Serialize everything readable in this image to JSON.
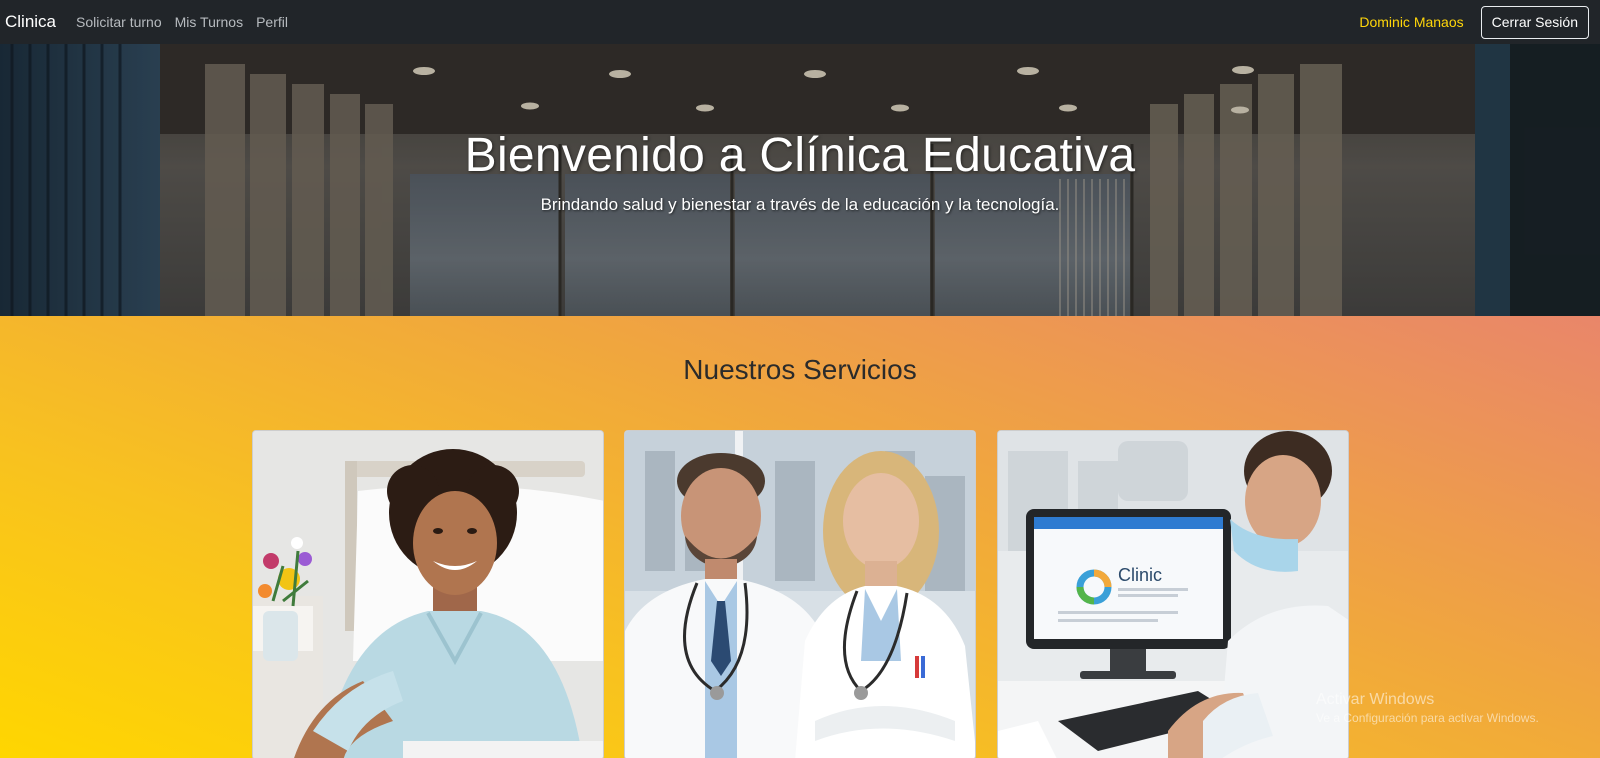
{
  "navbar": {
    "brand": "Clinica",
    "links": [
      "Solicitar turno",
      "Mis Turnos",
      "Perfil"
    ],
    "user_name": "Dominic Manaos",
    "logout_label": "Cerrar Sesión"
  },
  "hero": {
    "title": "Bienvenido a Clínica Educativa",
    "subtitle": "Brindando salud y bienestar a través de la educación y la tecnología."
  },
  "services": {
    "title": "Nuestros Servicios",
    "cards": [
      {
        "image": "smiling-patient-in-hospital-bed"
      },
      {
        "image": "two-doctors-with-stethoscopes"
      },
      {
        "image": "doctor-using-clinic-software",
        "screen_text": "Clinic"
      }
    ]
  },
  "watermark": {
    "line1": "Activar Windows",
    "line2": "Ve a Configuración para activar Windows."
  },
  "colors": {
    "navbar_bg": "#212529",
    "user_name": "#ffd60a",
    "services_gradient_start": "#ffd600",
    "services_gradient_end": "#e9866a"
  }
}
